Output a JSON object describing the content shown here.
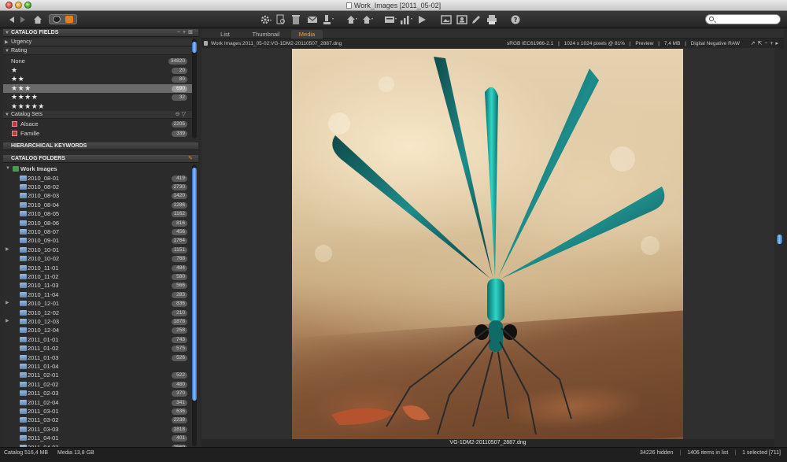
{
  "window": {
    "title": "Work_Images [2011_05-02]"
  },
  "toolbar": {
    "search_placeholder": ""
  },
  "left_panel": {
    "catalog_fields": {
      "header": "CATALOG FIELDS",
      "urgency": "Urgency",
      "rating": "Rating",
      "ratings": [
        {
          "label": "None",
          "count": "34820"
        },
        {
          "label": "★",
          "count": "20"
        },
        {
          "label": "★★",
          "count": "80"
        },
        {
          "label": "★★★",
          "count": "690"
        },
        {
          "label": "★★★★",
          "count": "32"
        },
        {
          "label": "★★★★★",
          "count": ""
        }
      ],
      "catalog_sets": "Catalog Sets",
      "sets": [
        {
          "label": "Alsace",
          "count": "2205"
        },
        {
          "label": "Famille",
          "count": "339"
        }
      ]
    },
    "hierarchical_keywords": {
      "header": "HIERARCHICAL KEYWORDS"
    },
    "catalog_folders": {
      "header": "CATALOG FOLDERS",
      "root": "Work Images",
      "folders": [
        {
          "label": "2010_08-01",
          "count": "419"
        },
        {
          "label": "2010_08-02",
          "count": "2730"
        },
        {
          "label": "2010_08-03",
          "count": "1420"
        },
        {
          "label": "2010_08-04",
          "count": "1286"
        },
        {
          "label": "2010_08-05",
          "count": "1162"
        },
        {
          "label": "2010_08-06",
          "count": "816"
        },
        {
          "label": "2010_08-07",
          "count": "456"
        },
        {
          "label": "2010_09-01",
          "count": "1764"
        },
        {
          "label": "2010_10-01",
          "count": "1151"
        },
        {
          "label": "2010_10-02",
          "count": "768"
        },
        {
          "label": "2010_11-01",
          "count": "484"
        },
        {
          "label": "2010_11-02",
          "count": "580"
        },
        {
          "label": "2010_11-03",
          "count": "566"
        },
        {
          "label": "2010_11-04",
          "count": "283"
        },
        {
          "label": "2010_12-01",
          "count": "836"
        },
        {
          "label": "2010_12-02",
          "count": "210"
        },
        {
          "label": "2010_12-03",
          "count": "1878"
        },
        {
          "label": "2010_12-04",
          "count": "258"
        },
        {
          "label": "2011_01-01",
          "count": "743"
        },
        {
          "label": "2011_01-02",
          "count": "575"
        },
        {
          "label": "2011_01-03",
          "count": "526"
        },
        {
          "label": "2011_01-04",
          "count": ""
        },
        {
          "label": "2011_02-01",
          "count": "522"
        },
        {
          "label": "2011_02-02",
          "count": "480"
        },
        {
          "label": "2011_02-03",
          "count": "370"
        },
        {
          "label": "2011_02-04",
          "count": "341"
        },
        {
          "label": "2011_03-01",
          "count": "636"
        },
        {
          "label": "2011_03-02",
          "count": "2238"
        },
        {
          "label": "2011_03-03",
          "count": "1818"
        },
        {
          "label": "2011_04-01",
          "count": "401"
        },
        {
          "label": "2011_04-02",
          "count": "2569"
        }
      ]
    }
  },
  "tabs": [
    {
      "label": "List"
    },
    {
      "label": "Thumbnail"
    },
    {
      "label": "Media"
    }
  ],
  "infobar": {
    "path": "Work Images:2011_05-02:VG-1DM2-20110507_2887.dng",
    "color_profile": "sRGB IEC61966-2.1",
    "dimensions": "1024 x 1024 pixels @ 81%",
    "mode": "Preview",
    "size": "7,4 MB",
    "format": "Digital Negative RAW"
  },
  "viewer": {
    "caption": "VG-1DM2-20110507_2887.dng"
  },
  "statusbar": {
    "catalog": "Catalog  516,4 MB",
    "media": "Media  13,8 GB",
    "hidden": "34226 hidden",
    "items": "1406 items in list",
    "selected": "1 selected [711]"
  },
  "colors": {
    "active_tab": "#f0a030",
    "accent_scroll": "#2c6cd6"
  }
}
